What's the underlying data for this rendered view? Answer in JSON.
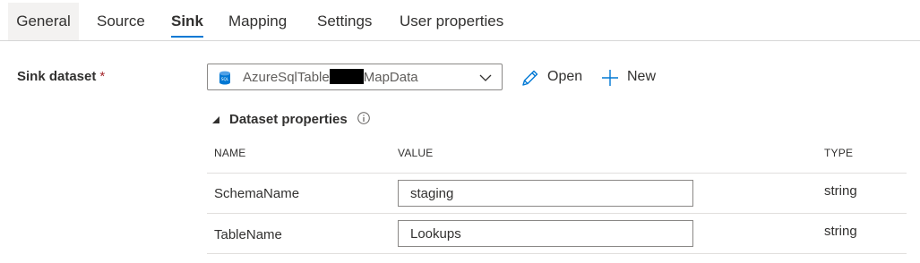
{
  "tabs": [
    {
      "label": "General"
    },
    {
      "label": "Source"
    },
    {
      "label": "Sink",
      "active": true
    },
    {
      "label": "Mapping"
    },
    {
      "label": "Settings"
    },
    {
      "label": "User properties"
    }
  ],
  "sink": {
    "label": "Sink dataset",
    "required_mark": "*",
    "dataset_prefix": "AzureSqlTable",
    "dataset_suffix": "MapData",
    "dataset_icon": "sql-database-icon",
    "open_label": "Open",
    "new_label": "New"
  },
  "dataset_properties": {
    "title": "Dataset properties",
    "columns": [
      "NAME",
      "VALUE",
      "TYPE"
    ],
    "rows": [
      {
        "name": "SchemaName",
        "value": "staging",
        "type": "string"
      },
      {
        "name": "TableName",
        "value": "Lookups",
        "type": "string"
      }
    ]
  },
  "colors": {
    "accent": "#0078d4",
    "required": "#a4262c",
    "active_tab_bg": "#f3f2f1"
  }
}
